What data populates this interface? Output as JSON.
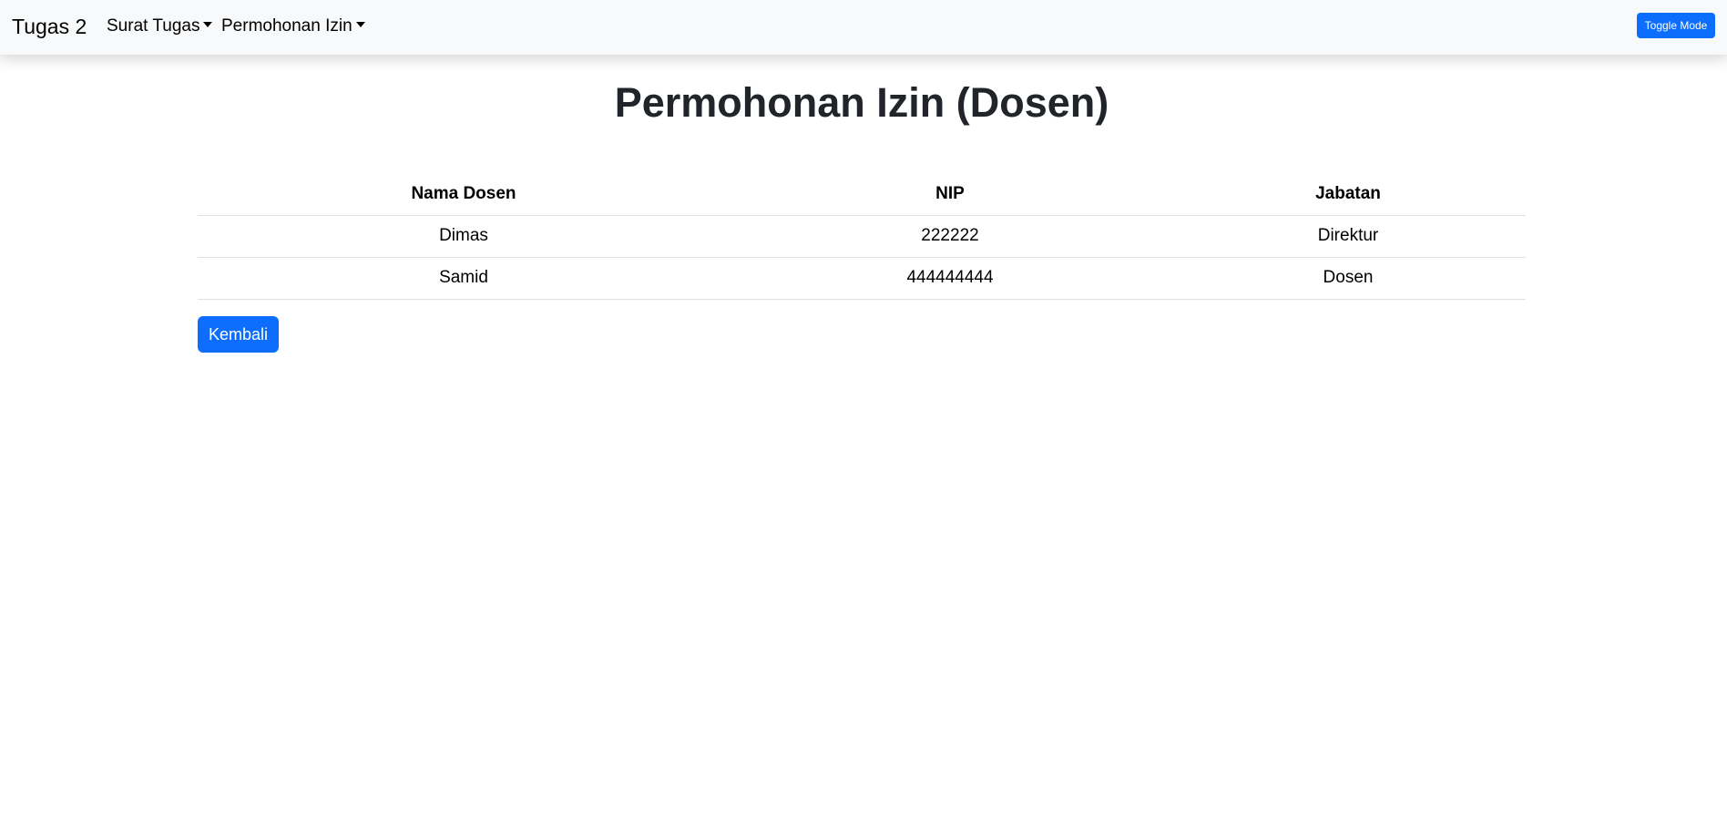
{
  "navbar": {
    "brand": "Tugas 2",
    "menus": [
      {
        "label": "Surat Tugas"
      },
      {
        "label": "Permohonan Izin"
      }
    ],
    "toggle_label": "Toggle Mode"
  },
  "page": {
    "title": "Permohonan Izin (Dosen)"
  },
  "table": {
    "headers": [
      "Nama Dosen",
      "NIP",
      "Jabatan"
    ],
    "rows": [
      [
        "Dimas",
        "222222",
        "Direktur"
      ],
      [
        "Samid",
        "444444444",
        "Dosen"
      ]
    ]
  },
  "actions": {
    "back_label": "Kembali"
  },
  "colors": {
    "primary": "#0d6efd",
    "navbar_bg": "#f8f9fa",
    "row_border": "#dee2e6"
  }
}
